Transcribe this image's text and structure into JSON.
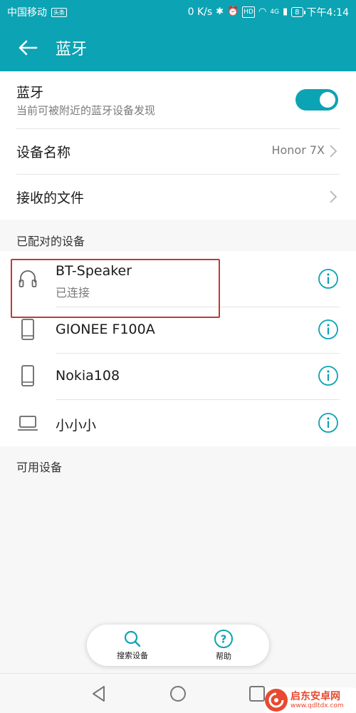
{
  "status_bar": {
    "carrier": "中国移动",
    "carrier_badge": "头条",
    "net_speed": "0 K/s",
    "network": "4G",
    "battery": "8",
    "time": "下午4:14"
  },
  "header": {
    "title": "蓝牙"
  },
  "bluetooth": {
    "title": "蓝牙",
    "subtitle": "当前可被附近的蓝牙设备发现",
    "enabled": true
  },
  "device_name": {
    "label": "设备名称",
    "value": "Honor 7X"
  },
  "received_files": {
    "label": "接收的文件"
  },
  "paired_section": {
    "label": "已配对的设备"
  },
  "paired_devices": [
    {
      "name": "BT-Speaker",
      "status": "已连接",
      "icon": "headphones-icon"
    },
    {
      "name": "GIONEE F100A",
      "icon": "phone-icon"
    },
    {
      "name": "Nokia108",
      "icon": "phone-icon"
    },
    {
      "name": "小小小",
      "icon": "laptop-icon"
    }
  ],
  "available_section": {
    "label": "可用设备"
  },
  "bottom_actions": [
    {
      "label": "搜索设备",
      "icon": "search-icon"
    },
    {
      "label": "帮助",
      "icon": "help-icon"
    }
  ],
  "watermark": {
    "title": "启东安卓网",
    "url": "www.qdltdx.com"
  },
  "colors": {
    "accent": "#0ca3b4",
    "highlight": "#c0393b"
  }
}
